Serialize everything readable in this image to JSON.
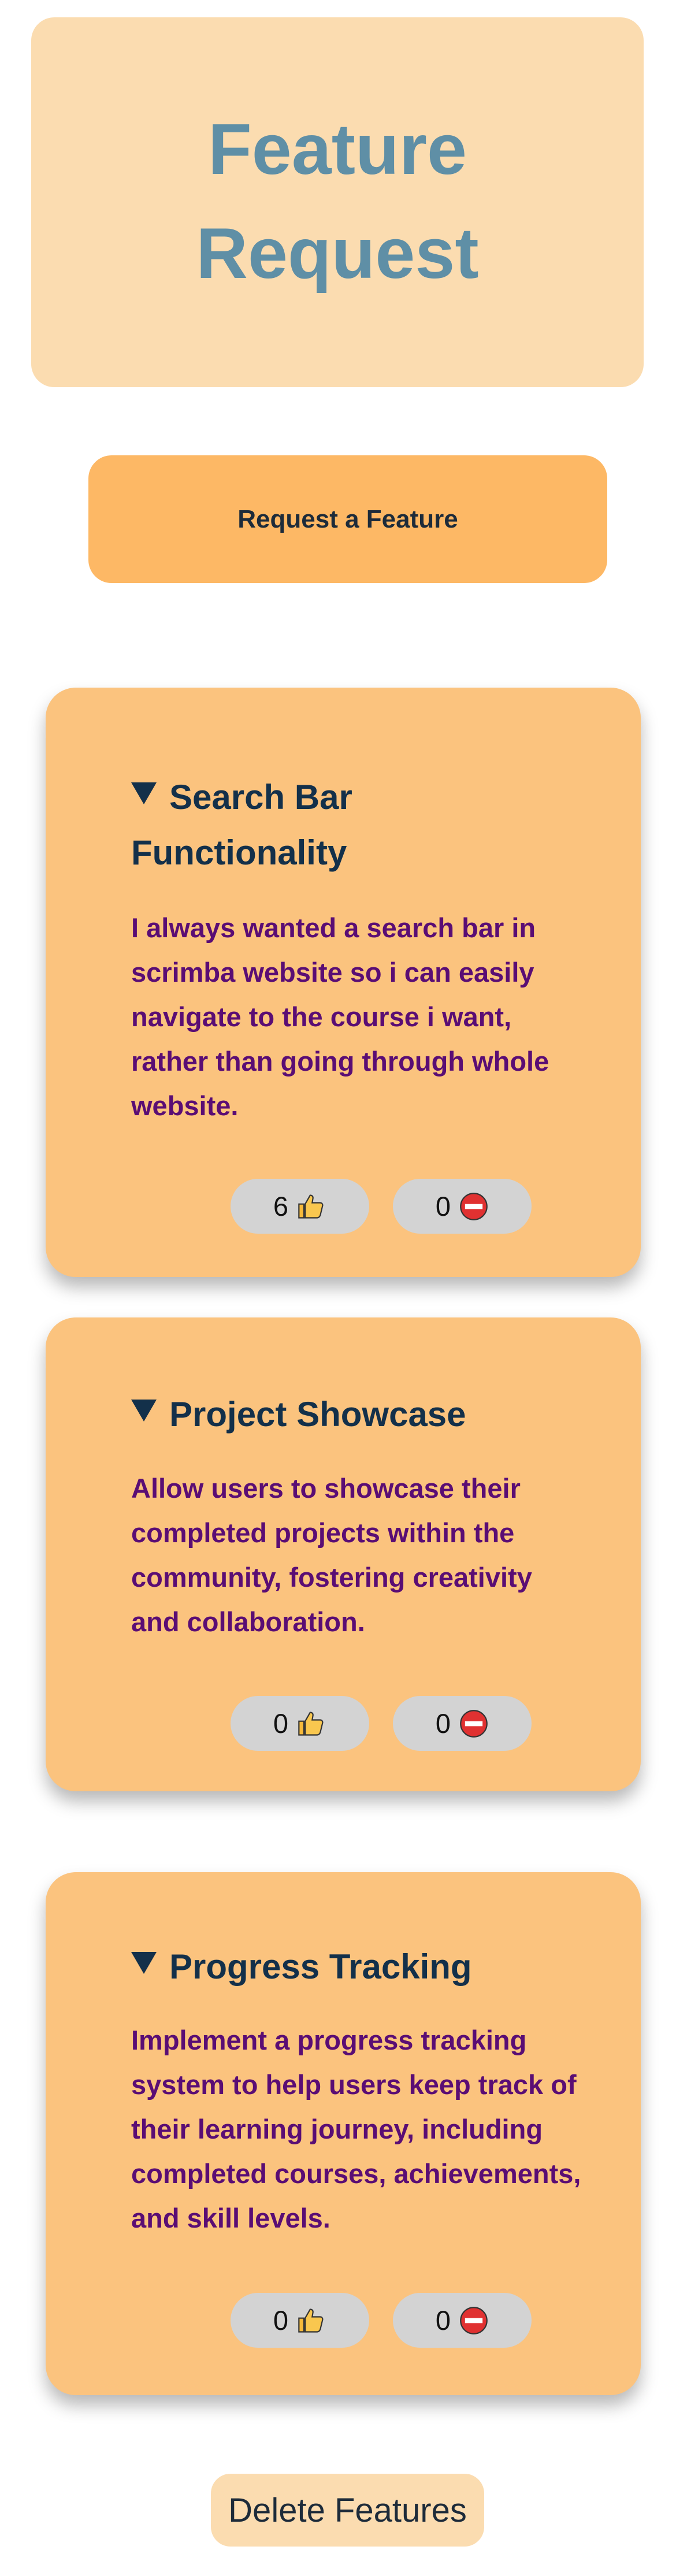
{
  "header": {
    "title": "Feature Request"
  },
  "actions": {
    "request_label": "Request a Feature",
    "delete_label": "Delete Features"
  },
  "features": [
    {
      "title": "Search Bar Functionality",
      "description": "I always wanted a search bar in scrimba website so i can easily navigate to the course i want, rather than going through whole website.",
      "upvotes": "6",
      "downvotes": "0"
    },
    {
      "title": "Project Showcase",
      "description": "Allow users to showcase their completed projects within the community, fostering creativity and collaboration.",
      "upvotes": "0",
      "downvotes": "0"
    },
    {
      "title": "Progress Tracking",
      "description": "Implement a progress tracking system to help users keep track of their learning journey, including completed courses, achievements, and skill levels.",
      "upvotes": "0",
      "downvotes": "0"
    }
  ],
  "icons": {
    "expand": "triangle-down-icon",
    "upvote": "thumbs-up-icon",
    "downvote": "no-entry-icon"
  },
  "colors": {
    "header_bg": "#fbdcb0",
    "title_text": "#5f8fa6",
    "request_button_bg": "#fdb865",
    "card_bg": "#fbc37e",
    "feature_title_text": "#13304a",
    "feature_desc_text": "#5a0d74",
    "vote_button_bg": "#d3d3d3"
  }
}
